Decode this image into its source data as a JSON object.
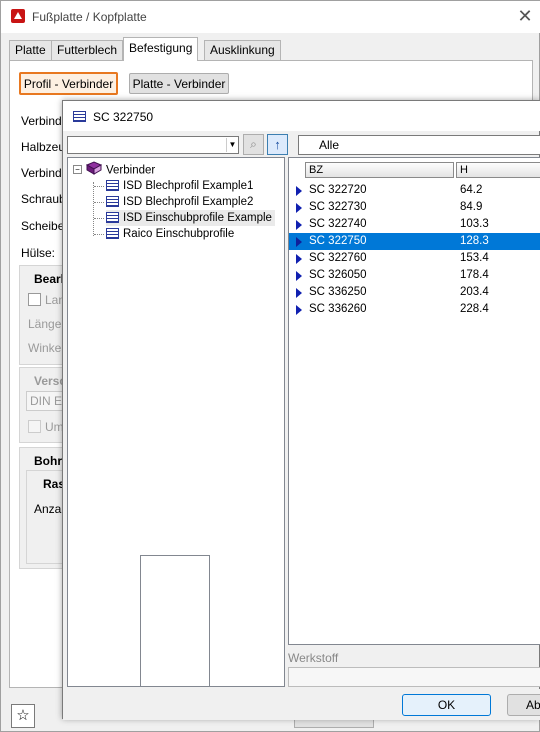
{
  "window": {
    "title": "Fußplatte / Kopfplatte",
    "tabs": [
      "Platte",
      "Futterblech",
      "Befestigung",
      "Ausklinkung"
    ],
    "active_tab": "Befestigung"
  },
  "panel": {
    "button_profil": "Profil - Verbinder",
    "button_platte": "Platte - Verbinder",
    "labels": [
      "Verbinde",
      "Halbzeu",
      "Verbinde",
      "Schraub",
      "Scheibe",
      "Hülse:"
    ],
    "group_bearb": "Bearb",
    "check_lang": "Lan",
    "laenge": "Länge:",
    "winkel": "Winkel",
    "group_versc": "Versc",
    "din": "DIN E",
    "check_um": "Um",
    "group_bohr": "Bohr",
    "group_ras": "Ras",
    "anzahl": "Anzah"
  },
  "dialog": {
    "title": "SC  322750",
    "filter_value": "Alle",
    "tree": {
      "root": "Verbinder",
      "items": [
        "ISD Blechprofil Example1",
        "ISD Blechprofil Example2",
        "ISD Einschubprofile Example",
        "Raico Einschubprofile"
      ],
      "selected_index": 2
    },
    "columns": {
      "bz": "BZ",
      "h": "H"
    },
    "rows": [
      {
        "bz": "SC  322720",
        "h": "64.2"
      },
      {
        "bz": "SC  322730",
        "h": "84.9"
      },
      {
        "bz": "SC  322740",
        "h": "103.3"
      },
      {
        "bz": "SC  322750",
        "h": "128.3"
      },
      {
        "bz": "SC  322760",
        "h": "153.4"
      },
      {
        "bz": "SC  326050",
        "h": "178.4"
      },
      {
        "bz": "SC  336250",
        "h": "203.4"
      },
      {
        "bz": "SC  336260",
        "h": "228.4"
      }
    ],
    "selected_row": 3,
    "werkstoff_label": "Werkstoff",
    "ok_label": "OK",
    "cancel_label": "Abb"
  },
  "colors": {
    "selection": "#0078d7",
    "accent_border": "#e87820"
  }
}
